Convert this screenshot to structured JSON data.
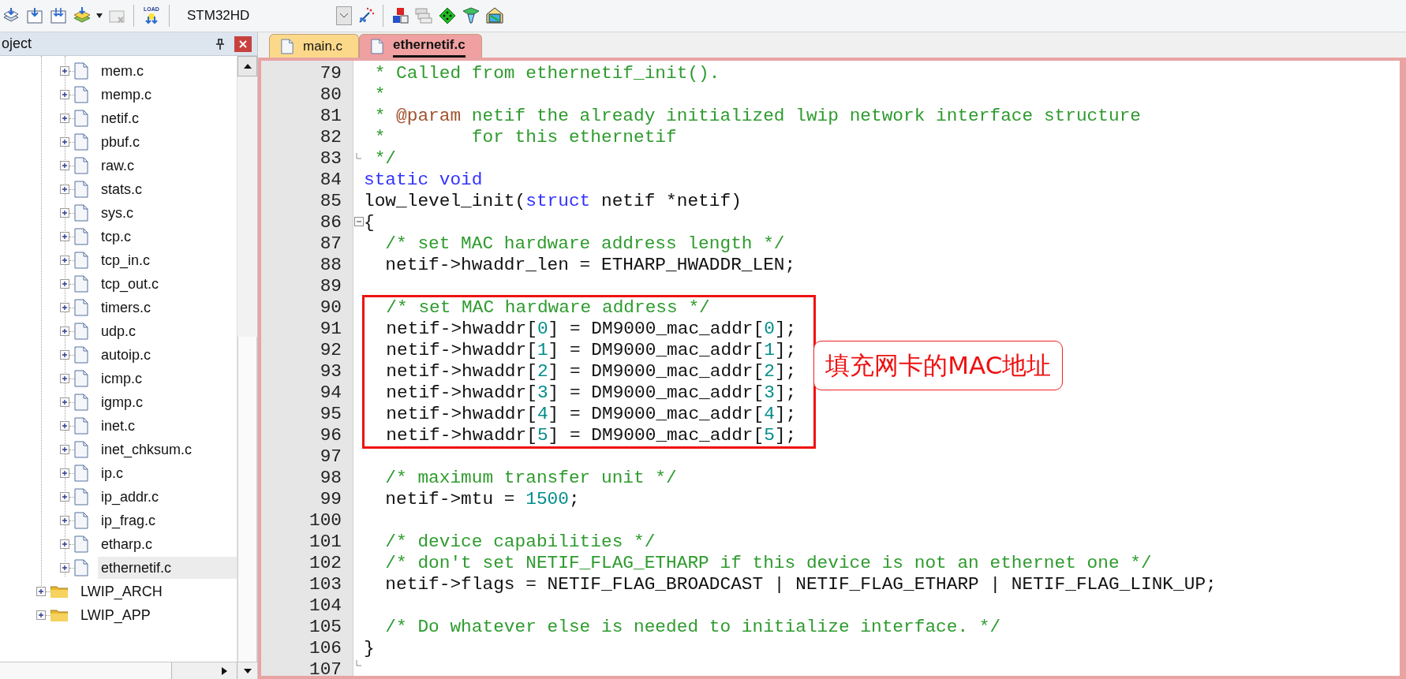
{
  "toolbar": {
    "load_label": "LOAD",
    "target": "STM32HD"
  },
  "project_panel": {
    "title": "oject",
    "tree": {
      "group_children": [
        {
          "label": "mem.c",
          "kind": "file",
          "selected": false
        },
        {
          "label": "memp.c",
          "kind": "file",
          "selected": false
        },
        {
          "label": "netif.c",
          "kind": "file",
          "selected": false
        },
        {
          "label": "pbuf.c",
          "kind": "file",
          "selected": false
        },
        {
          "label": "raw.c",
          "kind": "file",
          "selected": false
        },
        {
          "label": "stats.c",
          "kind": "file",
          "selected": false
        },
        {
          "label": "sys.c",
          "kind": "file",
          "selected": false
        },
        {
          "label": "tcp.c",
          "kind": "file",
          "selected": false
        },
        {
          "label": "tcp_in.c",
          "kind": "file",
          "selected": false
        },
        {
          "label": "tcp_out.c",
          "kind": "file",
          "selected": false
        },
        {
          "label": "timers.c",
          "kind": "file",
          "selected": false
        },
        {
          "label": "udp.c",
          "kind": "file",
          "selected": false
        },
        {
          "label": "autoip.c",
          "kind": "file",
          "selected": false
        },
        {
          "label": "icmp.c",
          "kind": "file",
          "selected": false
        },
        {
          "label": "igmp.c",
          "kind": "file",
          "selected": false
        },
        {
          "label": "inet.c",
          "kind": "file",
          "selected": false
        },
        {
          "label": "inet_chksum.c",
          "kind": "file",
          "selected": false
        },
        {
          "label": "ip.c",
          "kind": "file",
          "selected": false
        },
        {
          "label": "ip_addr.c",
          "kind": "file",
          "selected": false
        },
        {
          "label": "ip_frag.c",
          "kind": "file",
          "selected": false
        },
        {
          "label": "etharp.c",
          "kind": "file",
          "selected": false
        },
        {
          "label": "ethernetif.c",
          "kind": "file",
          "selected": true
        }
      ],
      "groups": [
        {
          "label": "LWIP_ARCH",
          "kind": "folder",
          "selected": false
        },
        {
          "label": "LWIP_APP",
          "kind": "folder",
          "selected": false
        }
      ]
    }
  },
  "tabs": [
    {
      "label": "main.c",
      "selected": false,
      "color": "#fcd98a"
    },
    {
      "label": "ethernetif.c",
      "selected": true,
      "color": "#f0a0a0"
    }
  ],
  "editor": {
    "callout": "填充网卡的MAC地址",
    "lines": [
      {
        "number": "79",
        "fold_start": false,
        "fold_end": false,
        "boxed": false,
        "segments": [
          {
            "text": " * Called from ethernetif_init().",
            "kind": "comment"
          }
        ]
      },
      {
        "number": "80",
        "fold_start": false,
        "fold_end": false,
        "boxed": false,
        "segments": [
          {
            "text": " *",
            "kind": "comment"
          }
        ]
      },
      {
        "number": "81",
        "fold_start": false,
        "fold_end": false,
        "boxed": false,
        "segments": [
          {
            "text": " * ",
            "kind": "comment"
          },
          {
            "text": "@param",
            "kind": "doctag"
          },
          {
            "text": " netif the already initialized lwip network interface structure",
            "kind": "comment"
          }
        ]
      },
      {
        "number": "82",
        "fold_start": false,
        "fold_end": false,
        "boxed": false,
        "segments": [
          {
            "text": " *        for this ethernetif",
            "kind": "comment"
          }
        ]
      },
      {
        "number": "83",
        "fold_start": false,
        "fold_end": true,
        "boxed": false,
        "segments": [
          {
            "text": " */",
            "kind": "comment"
          }
        ]
      },
      {
        "number": "84",
        "fold_start": false,
        "fold_end": false,
        "boxed": false,
        "segments": [
          {
            "text": "static void",
            "kind": "keyword"
          }
        ]
      },
      {
        "number": "85",
        "fold_start": false,
        "fold_end": false,
        "boxed": false,
        "segments": [
          {
            "text": "low_level_init(",
            "kind": "plain"
          },
          {
            "text": "struct",
            "kind": "keyword"
          },
          {
            "text": " netif *netif)",
            "kind": "plain"
          }
        ]
      },
      {
        "number": "86",
        "fold_start": true,
        "fold_end": false,
        "boxed": false,
        "segments": [
          {
            "text": "{",
            "kind": "plain"
          }
        ]
      },
      {
        "number": "87",
        "fold_start": false,
        "fold_end": false,
        "boxed": false,
        "segments": [
          {
            "text": "  /* set MAC hardware address length */",
            "kind": "comment"
          }
        ]
      },
      {
        "number": "88",
        "fold_start": false,
        "fold_end": false,
        "boxed": false,
        "segments": [
          {
            "text": "  netif->hwaddr_len = ETHARP_HWADDR_LEN;",
            "kind": "plain"
          }
        ]
      },
      {
        "number": "89",
        "fold_start": false,
        "fold_end": false,
        "boxed": false
      },
      {
        "number": "90",
        "fold_start": false,
        "fold_end": false,
        "boxed": true,
        "segments": [
          {
            "text": "  /* set MAC hardware address */",
            "kind": "comment"
          }
        ]
      },
      {
        "number": "91",
        "fold_start": false,
        "fold_end": false,
        "boxed": true,
        "segments": [
          {
            "text": "  netif->hwaddr[",
            "kind": "plain"
          },
          {
            "text": "0",
            "kind": "number"
          },
          {
            "text": "] = DM9000_mac_addr[",
            "kind": "plain"
          },
          {
            "text": "0",
            "kind": "number"
          },
          {
            "text": "];",
            "kind": "plain"
          }
        ]
      },
      {
        "number": "92",
        "fold_start": false,
        "fold_end": false,
        "boxed": true,
        "segments": [
          {
            "text": "  netif->hwaddr[",
            "kind": "plain"
          },
          {
            "text": "1",
            "kind": "number"
          },
          {
            "text": "] = DM9000_mac_addr[",
            "kind": "plain"
          },
          {
            "text": "1",
            "kind": "number"
          },
          {
            "text": "];",
            "kind": "plain"
          }
        ]
      },
      {
        "number": "93",
        "fold_start": false,
        "fold_end": false,
        "boxed": true,
        "segments": [
          {
            "text": "  netif->hwaddr[",
            "kind": "plain"
          },
          {
            "text": "2",
            "kind": "number"
          },
          {
            "text": "] = DM9000_mac_addr[",
            "kind": "plain"
          },
          {
            "text": "2",
            "kind": "number"
          },
          {
            "text": "];",
            "kind": "plain"
          }
        ]
      },
      {
        "number": "94",
        "fold_start": false,
        "fold_end": false,
        "boxed": true,
        "segments": [
          {
            "text": "  netif->hwaddr[",
            "kind": "plain"
          },
          {
            "text": "3",
            "kind": "number"
          },
          {
            "text": "] = DM9000_mac_addr[",
            "kind": "plain"
          },
          {
            "text": "3",
            "kind": "number"
          },
          {
            "text": "];",
            "kind": "plain"
          }
        ]
      },
      {
        "number": "95",
        "fold_start": false,
        "fold_end": false,
        "boxed": true,
        "segments": [
          {
            "text": "  netif->hwaddr[",
            "kind": "plain"
          },
          {
            "text": "4",
            "kind": "number"
          },
          {
            "text": "] = DM9000_mac_addr[",
            "kind": "plain"
          },
          {
            "text": "4",
            "kind": "number"
          },
          {
            "text": "];",
            "kind": "plain"
          }
        ]
      },
      {
        "number": "96",
        "fold_start": false,
        "fold_end": false,
        "boxed": true,
        "segments": [
          {
            "text": "  netif->hwaddr[",
            "kind": "plain"
          },
          {
            "text": "5",
            "kind": "number"
          },
          {
            "text": "] = DM9000_mac_addr[",
            "kind": "plain"
          },
          {
            "text": "5",
            "kind": "number"
          },
          {
            "text": "];",
            "kind": "plain"
          }
        ]
      },
      {
        "number": "97",
        "fold_start": false,
        "fold_end": false,
        "boxed": false
      },
      {
        "number": "98",
        "fold_start": false,
        "fold_end": false,
        "boxed": false,
        "segments": [
          {
            "text": "  /* maximum transfer unit */",
            "kind": "comment"
          }
        ]
      },
      {
        "number": "99",
        "fold_start": false,
        "fold_end": false,
        "boxed": false,
        "segments": [
          {
            "text": "  netif->mtu = ",
            "kind": "plain"
          },
          {
            "text": "1500",
            "kind": "number"
          },
          {
            "text": ";",
            "kind": "plain"
          }
        ]
      },
      {
        "number": "100",
        "fold_start": false,
        "fold_end": false,
        "boxed": false
      },
      {
        "number": "101",
        "fold_start": false,
        "fold_end": false,
        "boxed": false,
        "segments": [
          {
            "text": "  /* device capabilities */",
            "kind": "comment"
          }
        ]
      },
      {
        "number": "102",
        "fold_start": false,
        "fold_end": false,
        "boxed": false,
        "segments": [
          {
            "text": "  /* don't set NETIF_FLAG_ETHARP if this device is not an ethernet one */",
            "kind": "comment"
          }
        ]
      },
      {
        "number": "103",
        "fold_start": false,
        "fold_end": false,
        "boxed": false,
        "segments": [
          {
            "text": "  netif->flags = NETIF_FLAG_BROADCAST | NETIF_FLAG_ETHARP | NETIF_FLAG_LINK_UP;",
            "kind": "plain"
          }
        ]
      },
      {
        "number": "104",
        "fold_start": false,
        "fold_end": false,
        "boxed": false
      },
      {
        "number": "105",
        "fold_start": false,
        "fold_end": false,
        "boxed": false,
        "segments": [
          {
            "text": "  /* Do whatever else is needed to initialize interface. */",
            "kind": "comment"
          }
        ]
      },
      {
        "number": "106",
        "fold_start": false,
        "fold_end": false,
        "boxed": false,
        "segments": [
          {
            "text": "}",
            "kind": "plain"
          }
        ]
      },
      {
        "number": "107",
        "fold_start": false,
        "fold_end": true,
        "boxed": false
      }
    ]
  }
}
